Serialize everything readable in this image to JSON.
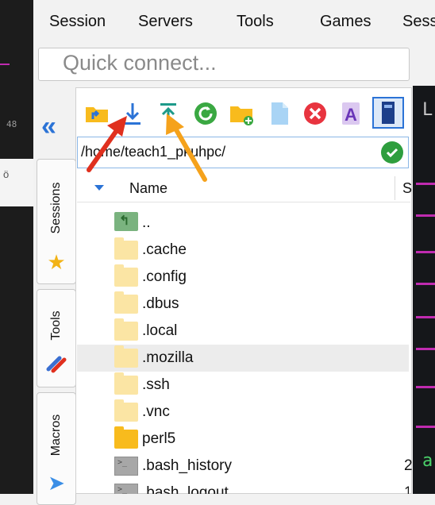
{
  "menubar": {
    "items": [
      {
        "label": "Session"
      },
      {
        "label": "Servers"
      },
      {
        "label": "Tools"
      },
      {
        "label": "Games"
      },
      {
        "label": "Sess"
      }
    ]
  },
  "quick_connect": {
    "placeholder": "Quick connect..."
  },
  "left_terminal": {
    "line1": "48",
    "line2": "ö"
  },
  "side_tabs": {
    "sessions": "Sessions",
    "tools": "Tools",
    "macros": "Macros"
  },
  "collapse_glyph": "«",
  "sftp": {
    "toolbar_icons": [
      "parent-directory-icon",
      "download-icon",
      "upload-icon",
      "refresh-icon",
      "new-folder-icon",
      "new-file-icon",
      "delete-icon",
      "rename-icon",
      "toggle-view-icon"
    ],
    "path": "/home/teach1_pkuhpc/",
    "columns": {
      "name": "Name",
      "size": "S"
    },
    "files": [
      {
        "name": "..",
        "kind": "up"
      },
      {
        "name": ".cache",
        "kind": "folder"
      },
      {
        "name": ".config",
        "kind": "folder"
      },
      {
        "name": ".dbus",
        "kind": "folder"
      },
      {
        "name": ".local",
        "kind": "folder"
      },
      {
        "name": ".mozilla",
        "kind": "folder",
        "highlighted": true
      },
      {
        "name": ".ssh",
        "kind": "folder"
      },
      {
        "name": ".vnc",
        "kind": "folder"
      },
      {
        "name": "perl5",
        "kind": "folder-strong"
      },
      {
        "name": ".bash_history",
        "kind": "file",
        "size": "2"
      },
      {
        "name": ".bash_logout",
        "kind": "file",
        "size": "1"
      }
    ]
  },
  "right_terminal": {
    "top_char": "L",
    "bottom_char": "a"
  },
  "colors": {
    "accent_blue": "#2b73d6",
    "folder_light": "#fbe5a4",
    "folder_dark": "#f8bb1d",
    "terminal_magenta": "#c02bb0",
    "arrow_red": "#e0301e",
    "arrow_orange": "#f5a21c"
  }
}
